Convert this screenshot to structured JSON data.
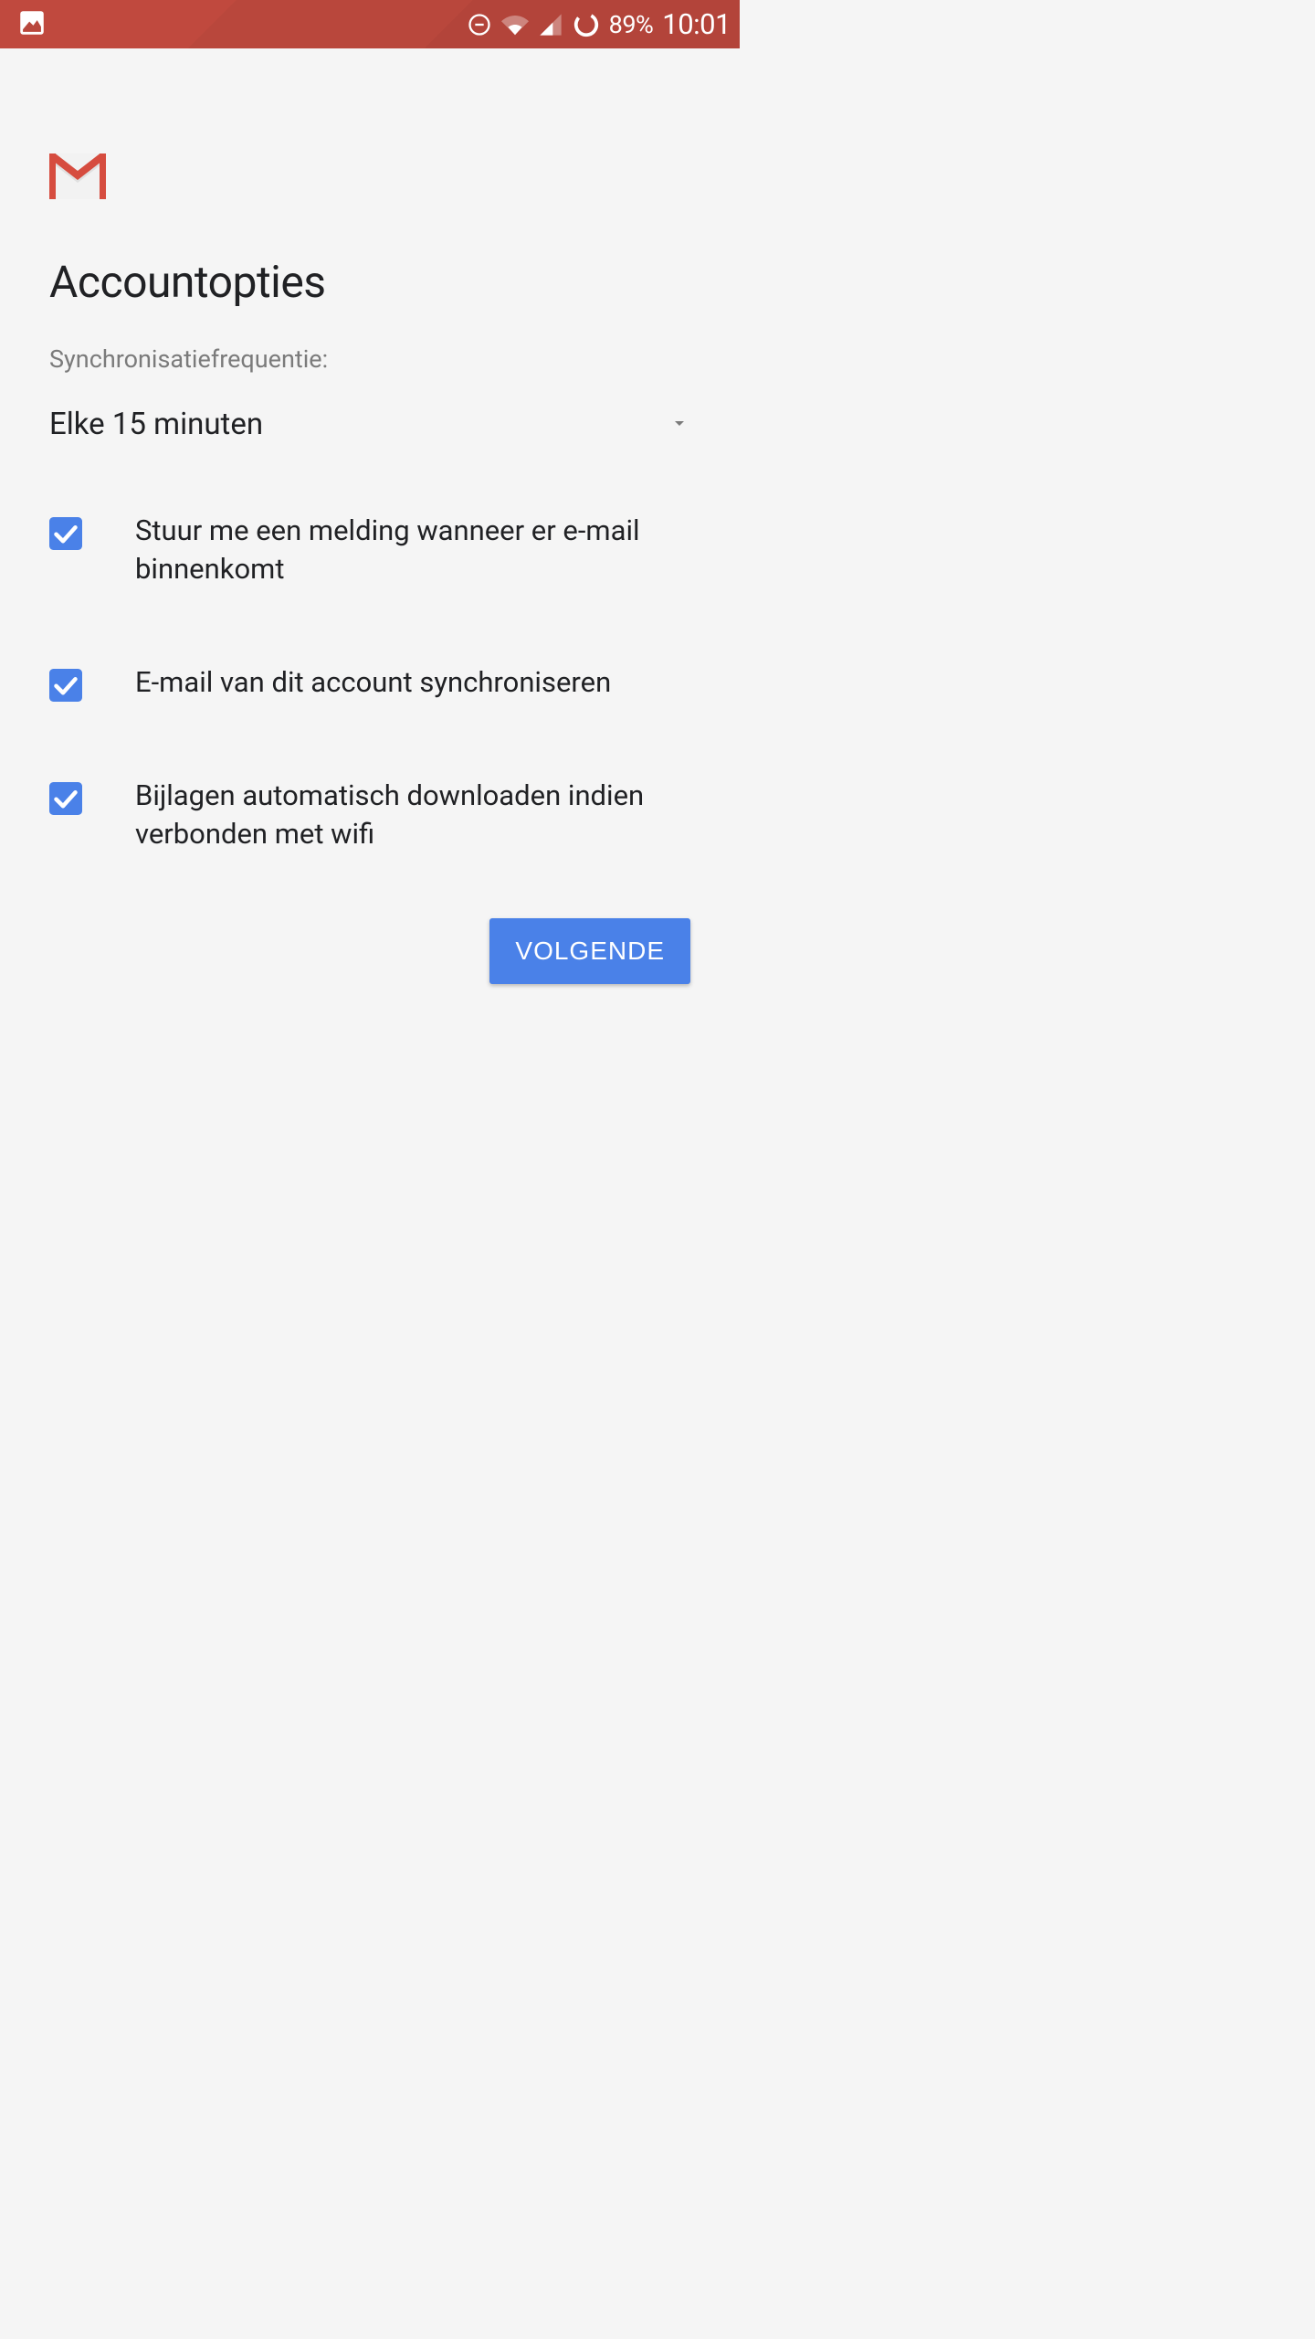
{
  "statusbar": {
    "battery_pct": "89%",
    "clock": "10:01"
  },
  "page": {
    "title": "Accountopties",
    "sync_label": "Synchronisatiefrequentie:",
    "sync_value": "Elke 15 minuten"
  },
  "options": [
    {
      "checked": true,
      "label": "Stuur me een melding wanneer er e-mail binnenkomt"
    },
    {
      "checked": true,
      "label": "E-mail van dit account synchroniseren"
    },
    {
      "checked": true,
      "label": "Bijlagen automatisch downloaden indien verbonden met wifi"
    }
  ],
  "buttons": {
    "next": "VOLGENDE"
  }
}
